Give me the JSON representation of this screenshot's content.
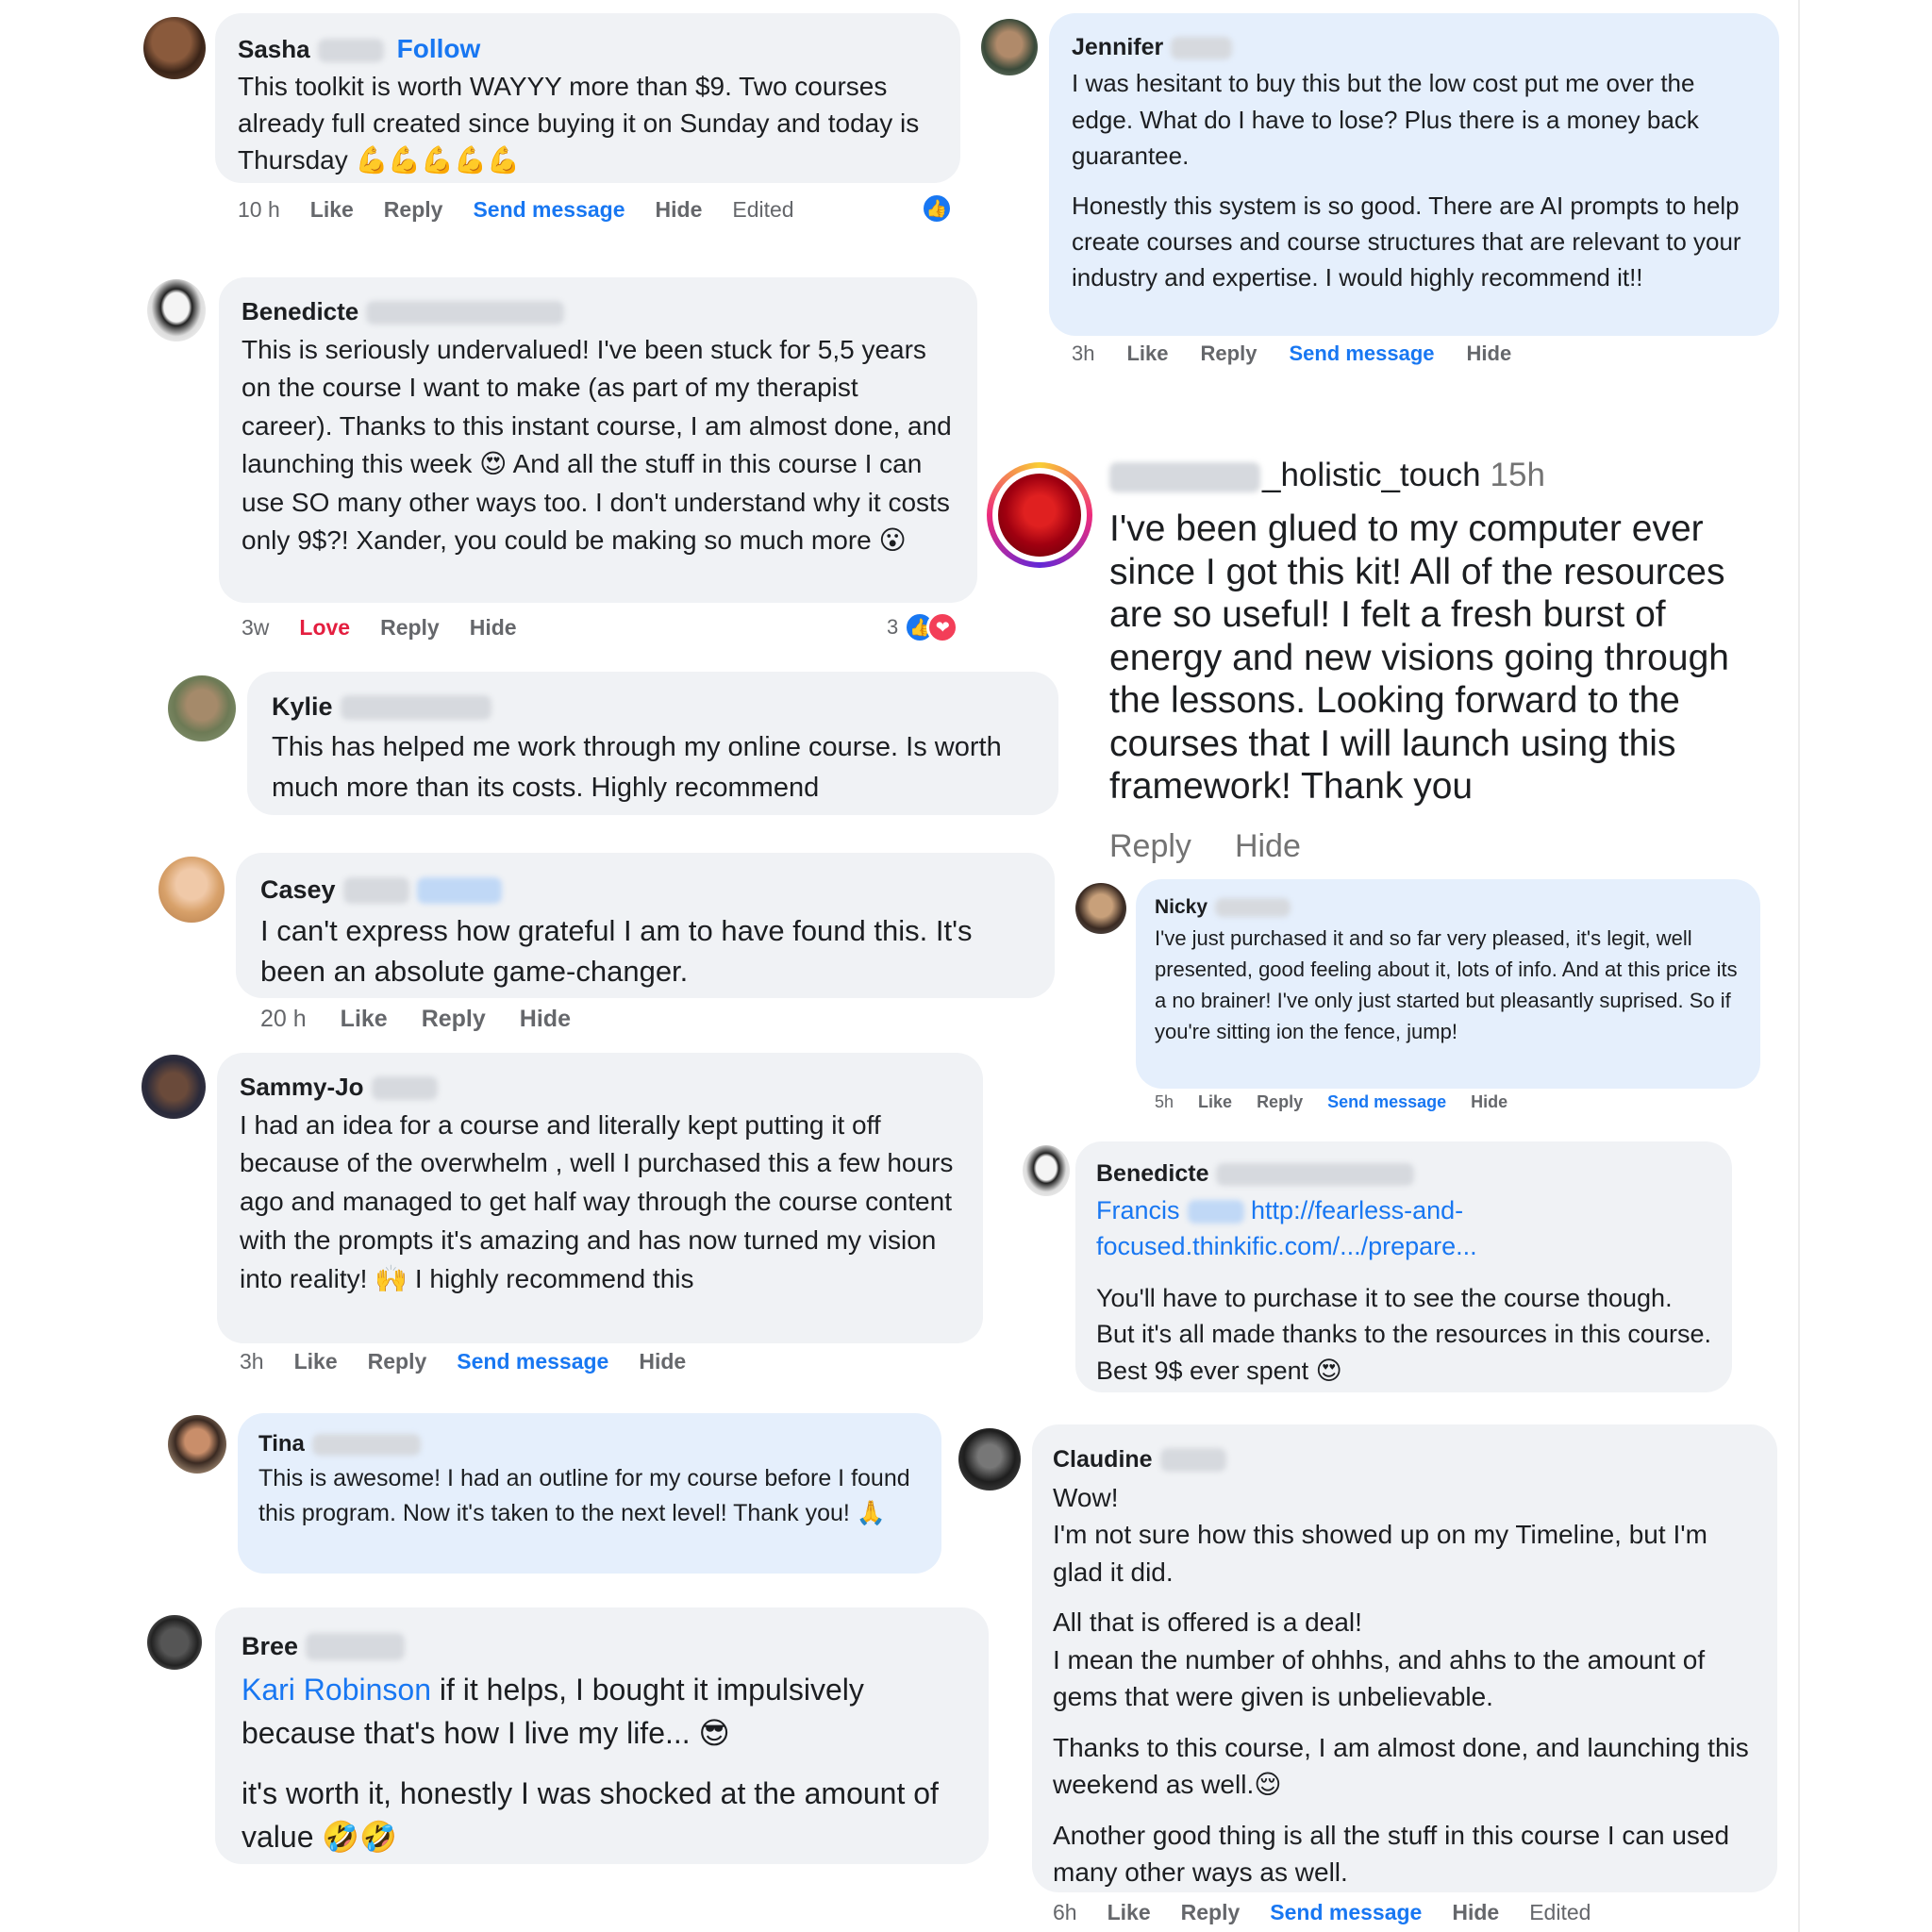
{
  "comments": {
    "sasha": {
      "name": "Sasha",
      "follow": "Follow",
      "text": "This toolkit is worth WAYYY more than $9. Two courses already full created since buying it on Sunday and today is Thursday 💪💪💪💪💪",
      "time": "10 h",
      "like": "Like",
      "reply": "Reply",
      "send": "Send message",
      "hide": "Hide",
      "edited": "Edited"
    },
    "benedicte1": {
      "name": "Benedicte",
      "text": "This is seriously undervalued! I've been stuck for 5,5 years on the course I want to make (as part of my therapist career). Thanks to this instant course, I am almost done, and launching this week 😍 And all the stuff in this course I can use SO many other ways too. I don't understand why it costs only 9$?! Xander, you could be making so much more 😮",
      "time": "3w",
      "love": "Love",
      "reply": "Reply",
      "hide": "Hide",
      "reaction_count": "3"
    },
    "kylie": {
      "name": "Kylie",
      "text": "This has helped me work through my online course. Is worth much more than its costs. Highly recommend"
    },
    "casey": {
      "name": "Casey",
      "text": "I can't express how grateful I am to have found this. It's been an absolute game-changer.",
      "time": "20 h",
      "like": "Like",
      "reply": "Reply",
      "hide": "Hide"
    },
    "sammyjo": {
      "name": "Sammy-Jo",
      "text": "I had an idea for a course and literally kept putting it off because of the overwhelm , well I purchased this a few hours ago and managed to get half way through the course content with the prompts it's amazing and has now turned my vision into reality! 🙌 I highly recommend this",
      "time": "3h",
      "like": "Like",
      "reply": "Reply",
      "send": "Send message",
      "hide": "Hide"
    },
    "tina": {
      "name": "Tina",
      "text": "This is awesome! I had an outline for my course before I found this program. Now it's taken to the next level! Thank you! 🙏"
    },
    "bree": {
      "name": "Bree",
      "mention": "Kari Robinson",
      "text1": " if it helps, I bought it impulsively because that's how I live my life... 😎",
      "text2": "it's worth it, honestly I was shocked at the amount of value 🤣🤣"
    },
    "jennifer": {
      "name": "Jennifer",
      "para1": "I was hesitant to buy this but the low cost put me over the edge. What do I have to lose? Plus there is a money back guarantee.",
      "para2": "Honestly this system is so good. There are AI prompts to help create courses and course structures that are relevant to your industry and expertise. I would highly recommend it!!",
      "time": "3h",
      "like": "Like",
      "reply": "Reply",
      "send": "Send message",
      "hide": "Hide"
    },
    "holistic": {
      "name": "_holistic_touch",
      "time": "15h",
      "text": "I've been glued to my computer ever since I got this kit! All of the resources are so useful! I felt a fresh burst of energy and new visions going through the lessons. Looking forward to the courses that I will launch using this framework! Thank you",
      "reply": "Reply",
      "hide": "Hide"
    },
    "nicky": {
      "name": "Nicky",
      "text": "I've just purchased it and so far very pleased, it's legit, well presented, good feeling about it, lots of info. And at this price its a no brainer! I've only just started but pleasantly suprised. So if you're sitting ion the fence, jump!",
      "time": "5h",
      "like": "Like",
      "reply": "Reply",
      "send": "Send message",
      "hide": "Hide"
    },
    "benedicte2": {
      "name": "Benedicte",
      "mention": "Francis",
      "link1": "http://fearless-and-",
      "link2": "focused.thinkific.com/.../prepare...",
      "text": "You'll have to purchase it to see the course though. But it's all made thanks to the resources in this course. Best 9$ ever spent 😍"
    },
    "claudine": {
      "name": "Claudine",
      "para1a": "Wow!",
      "para1b": "I'm not sure how this showed up on my Timeline, but I'm glad it did.",
      "para2a": "All that is offered is a deal!",
      "para2b": "I mean the number of ohhhs, and ahhs to the amount of gems that were given is unbelievable.",
      "para3": "Thanks to this course, I am almost done, and launching this weekend as well.😌",
      "para4": "Another good thing is all the stuff in this course I can used many other ways as well.",
      "time": "6h",
      "like": "Like",
      "reply": "Reply",
      "send": "Send message",
      "hide": "Hide",
      "edited": "Edited"
    }
  },
  "icons": {
    "like": "thumbs-up-icon",
    "love": "heart-icon"
  },
  "colors": {
    "link_blue": "#1877f2",
    "love_red": "#e41e3f",
    "bubble_gray": "#f0f2f5",
    "bubble_blue": "#e5effc"
  }
}
